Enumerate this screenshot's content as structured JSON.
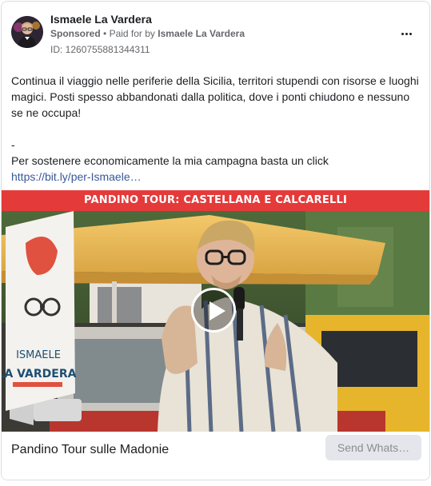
{
  "post": {
    "author": "Ismaele La Vardera",
    "sponsored": "Sponsored",
    "separator": "•",
    "paid_for_by": "Paid for by",
    "payer": "Ismaele La Vardera",
    "ad_id": "ID: 1260755881344311",
    "text_line1": "Continua il viaggio nelle periferie della Sicilia, territori stupendi con risorse e luoghi magici. Posti spesso abbandonati dalla politica, dove i ponti chiudono e nessuno se ne occupa!",
    "dash": "-",
    "text_line2": "Per sostenere economicamente la mia campagna basta un click",
    "link": "https://bit.ly/per-Ismaele…"
  },
  "media": {
    "banner": "PANDINO TOUR: CASTELLANA E CALCARELLI",
    "poster_name": "ISMAELE",
    "poster_surname": "LA VARDERA"
  },
  "footer": {
    "link_title": "Pandino Tour sulle Madonie",
    "cta_label": "Send Whats…"
  },
  "colors": {
    "banner_red": "#e53a3a",
    "link_blue": "#385898",
    "muted_text": "#65676b"
  },
  "icons": [
    "more-options-icon",
    "play-icon",
    "avatar"
  ]
}
